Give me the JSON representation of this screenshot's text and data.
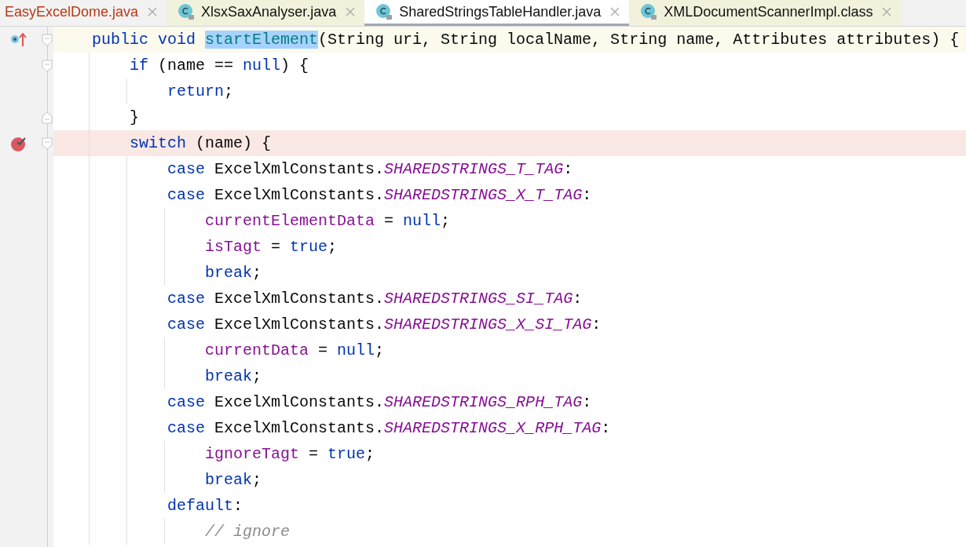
{
  "tabs": [
    {
      "label": "EasyExcelDome.java",
      "kind": "plain",
      "selected": false,
      "library": false,
      "error": true
    },
    {
      "label": "XlsxSaxAnalyser.java",
      "kind": "class",
      "selected": false,
      "library": true,
      "error": false
    },
    {
      "label": "SharedStringsTableHandler.java",
      "kind": "class",
      "selected": true,
      "library": false,
      "error": false
    },
    {
      "label": "XMLDocumentScannerImpl.class",
      "kind": "class",
      "selected": false,
      "library": true,
      "error": false
    }
  ],
  "lines": [
    {
      "override": true,
      "breakpoint": false,
      "caret_line": true,
      "fold_start": true,
      "fold_end": false,
      "tokens": [
        {
          "kind": "keyword",
          "text": "    public void "
        },
        {
          "kind": "selection",
          "text": "startElement"
        },
        {
          "kind": "plain",
          "text": "(String uri, String localName, String name, Attributes attributes) {"
        }
      ]
    },
    {
      "override": false,
      "breakpoint": false,
      "caret_line": false,
      "fold_start": true,
      "fold_end": false,
      "tokens": [
        {
          "kind": "keyword",
          "text": "        if "
        },
        {
          "kind": "plain",
          "text": "(name == "
        },
        {
          "kind": "keyword",
          "text": "null"
        },
        {
          "kind": "plain",
          "text": ") {"
        }
      ]
    },
    {
      "override": false,
      "breakpoint": false,
      "caret_line": false,
      "fold_start": false,
      "fold_end": false,
      "tokens": [
        {
          "kind": "keyword",
          "text": "            return"
        },
        {
          "kind": "plain",
          "text": ";"
        }
      ]
    },
    {
      "override": false,
      "breakpoint": false,
      "caret_line": false,
      "fold_start": false,
      "fold_end": true,
      "tokens": [
        {
          "kind": "plain",
          "text": "        }"
        }
      ]
    },
    {
      "override": false,
      "breakpoint": true,
      "caret_line": false,
      "fold_start": true,
      "fold_end": false,
      "tokens": [
        {
          "kind": "keyword",
          "text": "        switch "
        },
        {
          "kind": "plain",
          "text": "(name) {"
        }
      ]
    },
    {
      "override": false,
      "breakpoint": false,
      "caret_line": false,
      "fold_start": false,
      "fold_end": false,
      "tokens": [
        {
          "kind": "keyword",
          "text": "            case "
        },
        {
          "kind": "plain",
          "text": "ExcelXmlConstants."
        },
        {
          "kind": "constant",
          "text": "SHAREDSTRINGS_T_TAG"
        },
        {
          "kind": "plain",
          "text": ":"
        }
      ]
    },
    {
      "override": false,
      "breakpoint": false,
      "caret_line": false,
      "fold_start": false,
      "fold_end": false,
      "tokens": [
        {
          "kind": "keyword",
          "text": "            case "
        },
        {
          "kind": "plain",
          "text": "ExcelXmlConstants."
        },
        {
          "kind": "constant",
          "text": "SHAREDSTRINGS_X_T_TAG"
        },
        {
          "kind": "plain",
          "text": ":"
        }
      ]
    },
    {
      "override": false,
      "breakpoint": false,
      "caret_line": false,
      "fold_start": false,
      "fold_end": false,
      "tokens": [
        {
          "kind": "field",
          "text": "                currentElementData"
        },
        {
          "kind": "plain",
          "text": " = "
        },
        {
          "kind": "keyword",
          "text": "null"
        },
        {
          "kind": "plain",
          "text": ";"
        }
      ]
    },
    {
      "override": false,
      "breakpoint": false,
      "caret_line": false,
      "fold_start": false,
      "fold_end": false,
      "tokens": [
        {
          "kind": "field",
          "text": "                isTagt"
        },
        {
          "kind": "plain",
          "text": " = "
        },
        {
          "kind": "keyword",
          "text": "true"
        },
        {
          "kind": "plain",
          "text": ";"
        }
      ]
    },
    {
      "override": false,
      "breakpoint": false,
      "caret_line": false,
      "fold_start": false,
      "fold_end": false,
      "tokens": [
        {
          "kind": "keyword",
          "text": "                break"
        },
        {
          "kind": "plain",
          "text": ";"
        }
      ]
    },
    {
      "override": false,
      "breakpoint": false,
      "caret_line": false,
      "fold_start": false,
      "fold_end": false,
      "tokens": [
        {
          "kind": "keyword",
          "text": "            case "
        },
        {
          "kind": "plain",
          "text": "ExcelXmlConstants."
        },
        {
          "kind": "constant",
          "text": "SHAREDSTRINGS_SI_TAG"
        },
        {
          "kind": "plain",
          "text": ":"
        }
      ]
    },
    {
      "override": false,
      "breakpoint": false,
      "caret_line": false,
      "fold_start": false,
      "fold_end": false,
      "tokens": [
        {
          "kind": "keyword",
          "text": "            case "
        },
        {
          "kind": "plain",
          "text": "ExcelXmlConstants."
        },
        {
          "kind": "constant",
          "text": "SHAREDSTRINGS_X_SI_TAG"
        },
        {
          "kind": "plain",
          "text": ":"
        }
      ]
    },
    {
      "override": false,
      "breakpoint": false,
      "caret_line": false,
      "fold_start": false,
      "fold_end": false,
      "tokens": [
        {
          "kind": "field",
          "text": "                currentData"
        },
        {
          "kind": "plain",
          "text": " = "
        },
        {
          "kind": "keyword",
          "text": "null"
        },
        {
          "kind": "plain",
          "text": ";"
        }
      ]
    },
    {
      "override": false,
      "breakpoint": false,
      "caret_line": false,
      "fold_start": false,
      "fold_end": false,
      "tokens": [
        {
          "kind": "keyword",
          "text": "                break"
        },
        {
          "kind": "plain",
          "text": ";"
        }
      ]
    },
    {
      "override": false,
      "breakpoint": false,
      "caret_line": false,
      "fold_start": false,
      "fold_end": false,
      "tokens": [
        {
          "kind": "keyword",
          "text": "            case "
        },
        {
          "kind": "plain",
          "text": "ExcelXmlConstants."
        },
        {
          "kind": "constant",
          "text": "SHAREDSTRINGS_RPH_TAG"
        },
        {
          "kind": "plain",
          "text": ":"
        }
      ]
    },
    {
      "override": false,
      "breakpoint": false,
      "caret_line": false,
      "fold_start": false,
      "fold_end": false,
      "tokens": [
        {
          "kind": "keyword",
          "text": "            case "
        },
        {
          "kind": "plain",
          "text": "ExcelXmlConstants."
        },
        {
          "kind": "constant",
          "text": "SHAREDSTRINGS_X_RPH_TAG"
        },
        {
          "kind": "plain",
          "text": ":"
        }
      ]
    },
    {
      "override": false,
      "breakpoint": false,
      "caret_line": false,
      "fold_start": false,
      "fold_end": false,
      "tokens": [
        {
          "kind": "field",
          "text": "                ignoreTagt"
        },
        {
          "kind": "plain",
          "text": " = "
        },
        {
          "kind": "keyword",
          "text": "true"
        },
        {
          "kind": "plain",
          "text": ";"
        }
      ]
    },
    {
      "override": false,
      "breakpoint": false,
      "caret_line": false,
      "fold_start": false,
      "fold_end": false,
      "tokens": [
        {
          "kind": "keyword",
          "text": "                break"
        },
        {
          "kind": "plain",
          "text": ";"
        }
      ]
    },
    {
      "override": false,
      "breakpoint": false,
      "caret_line": false,
      "fold_start": false,
      "fold_end": false,
      "tokens": [
        {
          "kind": "keyword",
          "text": "            default"
        },
        {
          "kind": "plain",
          "text": ":"
        }
      ]
    },
    {
      "override": false,
      "breakpoint": false,
      "caret_line": false,
      "fold_start": false,
      "fold_end": false,
      "tokens": [
        {
          "kind": "comment",
          "text": "                // ignore"
        }
      ]
    }
  ]
}
